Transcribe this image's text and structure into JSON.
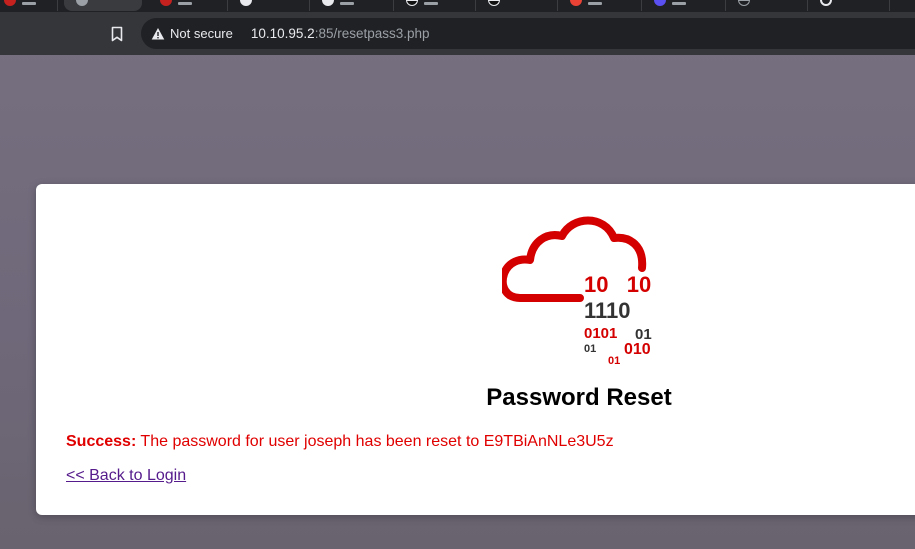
{
  "browser": {
    "security_label": "Not secure",
    "url_host": "10.10.95.2",
    "url_path": ":85/resetpass3.php",
    "tab_favicon_colors": [
      "#c5221f",
      "#9aa0a6",
      "#c5221f",
      "#e8eaed",
      "#e8eaed",
      "#e8eaed",
      "#ea4335",
      "#5a4ff0",
      "#9aa0a6",
      "#e8eaed"
    ]
  },
  "page": {
    "logo_binary": {
      "row1": "10   10",
      "row2": "1110",
      "row3a": "0101",
      "row3b": "01",
      "row4a": "01",
      "row4b": "010",
      "row5": "01"
    },
    "title": "Password Reset",
    "message_label": "Success:",
    "message_text": " The password for user joseph has been reset to E9TBiAnNLe3U5z",
    "back_link": "<< Back to Login"
  },
  "colors": {
    "accent_red": "#e00000",
    "logo_red": "#d40000",
    "link": "#551a8b",
    "background": "#716b7c"
  }
}
